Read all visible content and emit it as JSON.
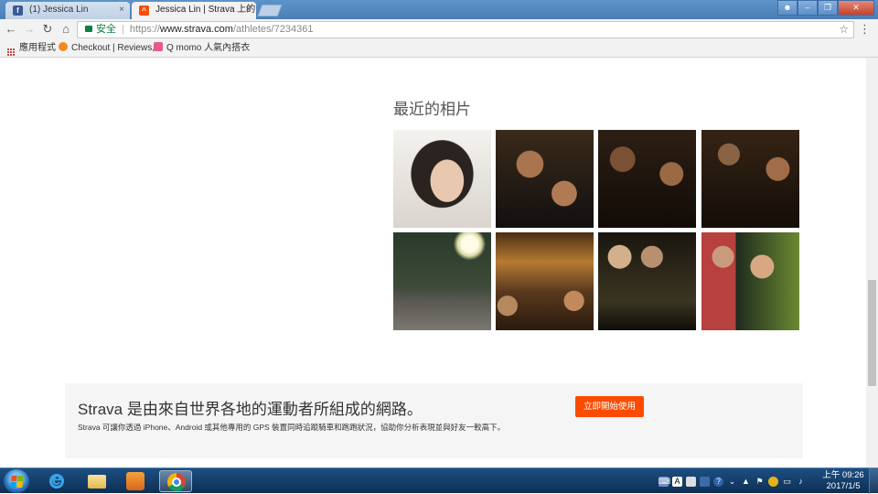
{
  "browser": {
    "tabs": [
      {
        "title": "(1) Jessica Lin",
        "icon": "facebook-icon",
        "close": "×"
      },
      {
        "title": "Jessica Lin | Strava 上的",
        "icon": "strava-icon",
        "close": "×"
      }
    ],
    "address": {
      "secure_label": "安全",
      "url_scheme": "https://",
      "url_host": "www.strava.com",
      "url_path": "/athletes/7234361"
    },
    "bookmarks": [
      {
        "label": "應用程式",
        "icon": "apps-grid-icon"
      },
      {
        "label": "Checkout | Reviews,",
        "icon": "checkout-icon"
      },
      {
        "label": "Q momo 人氣內搭衣",
        "icon": "momo-icon"
      }
    ]
  },
  "page": {
    "photos_heading": "最近的相片",
    "photos_count": 8,
    "banner": {
      "title": "Strava 是由來自世界各地的運動者所組成的網路。",
      "subtitle": "Strava 可讓你透過 iPhone、Android 或其他專用的 GPS 裝置同時追蹤騎車和跑跑狀況，協助你分析表現並與好友一較高下。",
      "cta_label": "立即開始使用"
    },
    "scroll_position": 0.55
  },
  "taskbar": {
    "apps": [
      "internet-explorer-icon",
      "file-explorer-icon",
      "media-player-icon",
      "chrome-icon"
    ],
    "active_app": "chrome-icon",
    "clock_time": "上午 09:26",
    "clock_date": "2017/1/5"
  },
  "colors": {
    "strava_orange": "#fc4c02",
    "secure_green": "#0b8043",
    "taskbar_blue": "#153f6b"
  }
}
